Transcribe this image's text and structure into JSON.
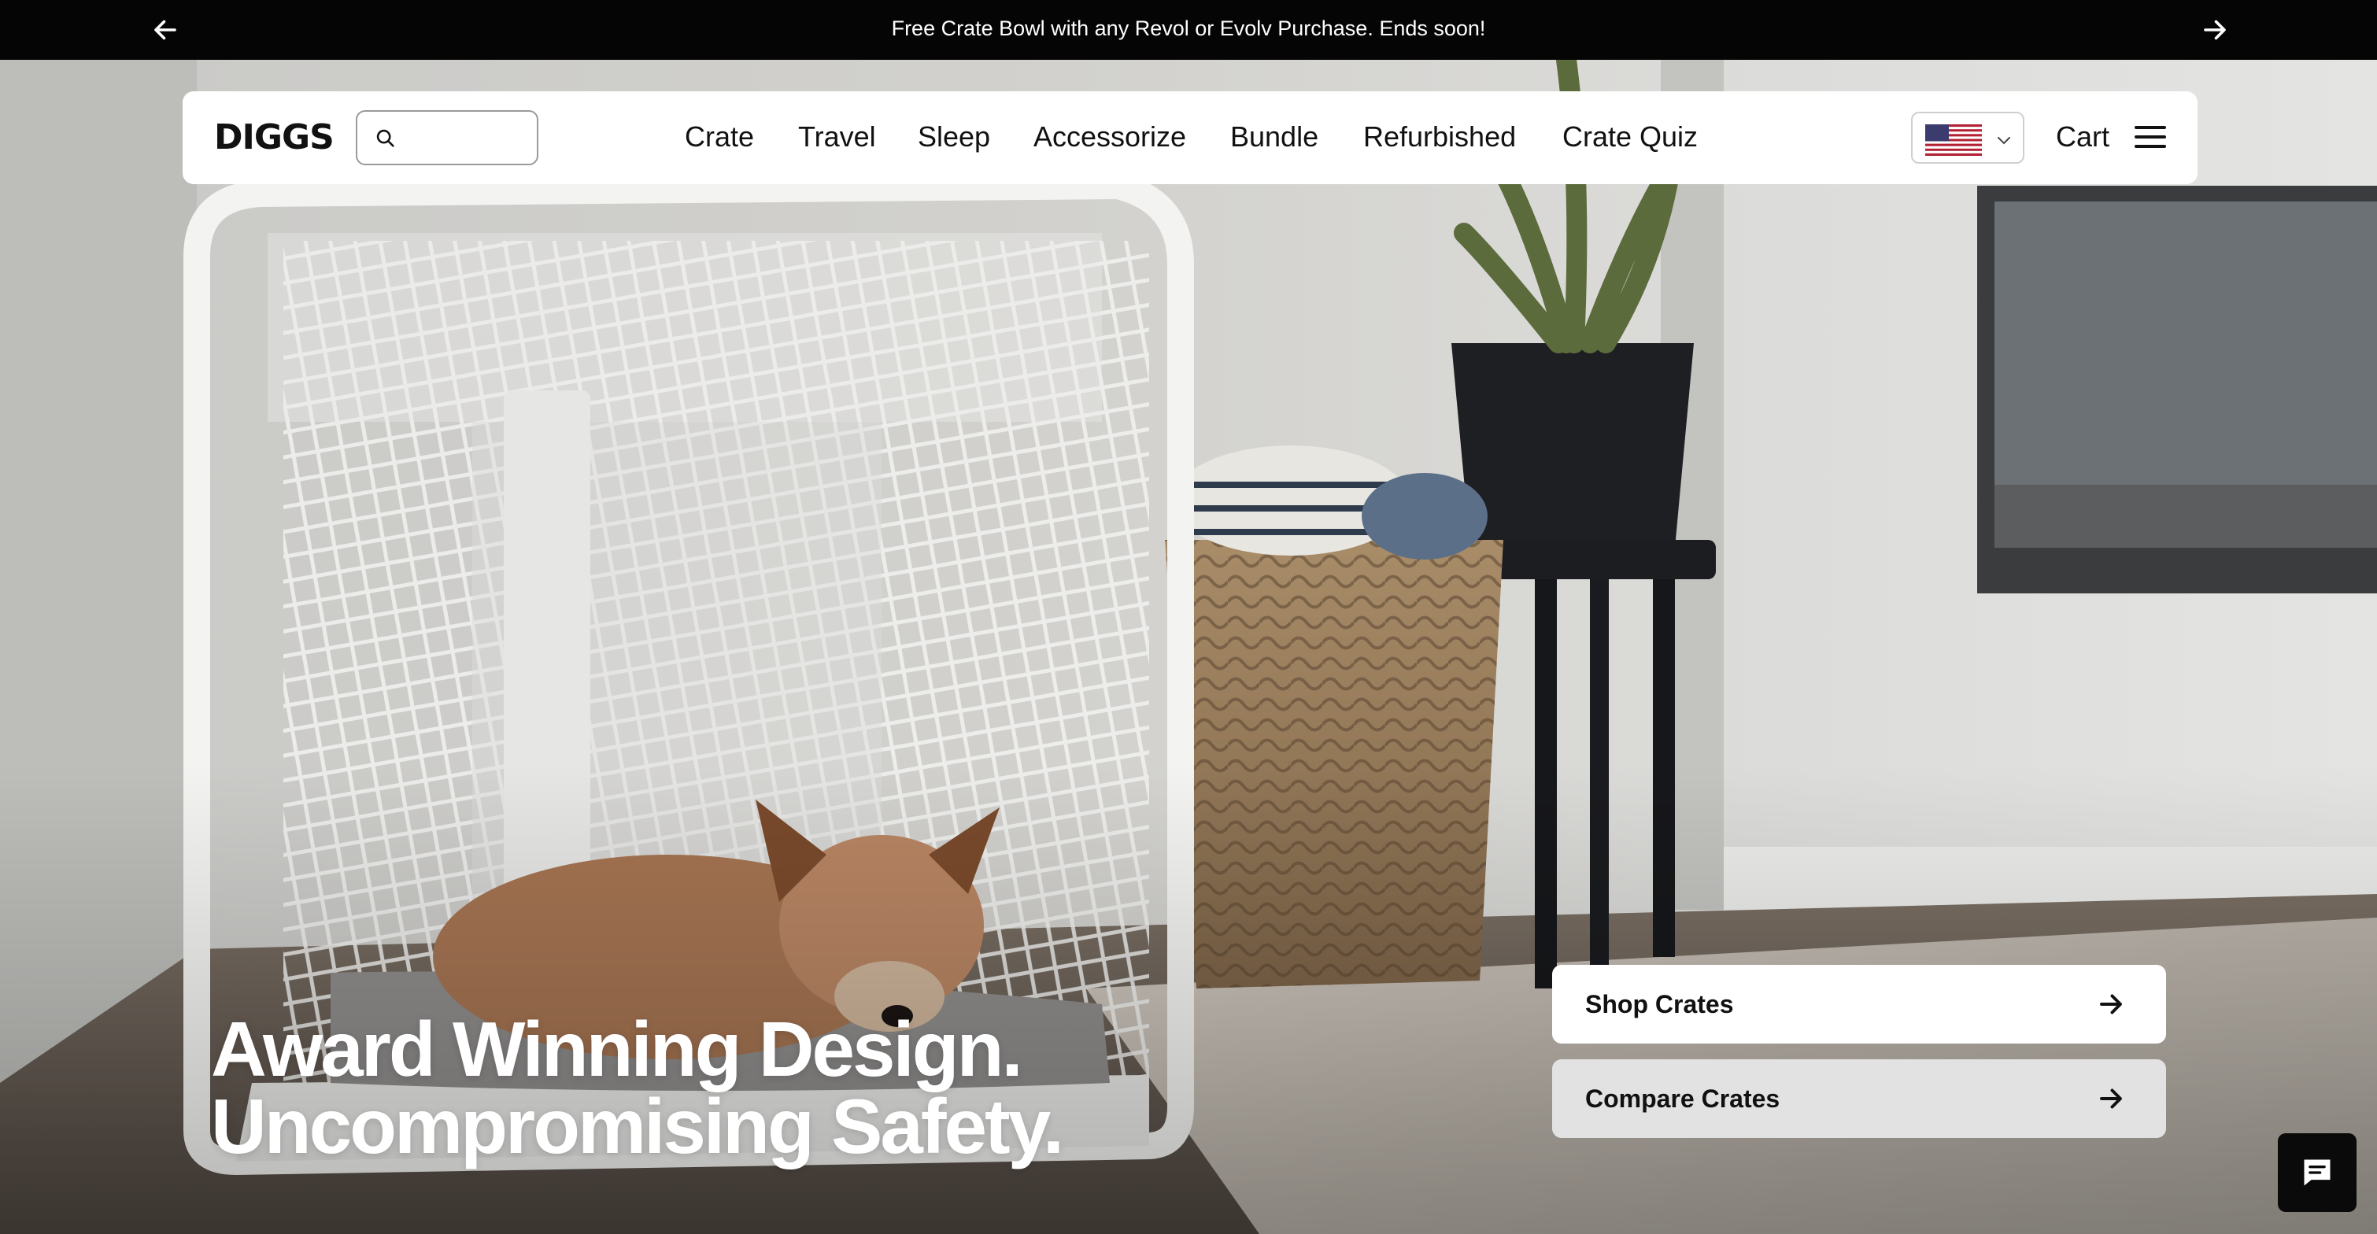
{
  "announcement": {
    "message": "Free Crate Bowl with any Revol or Evolv Purchase. Ends soon!",
    "prev_icon": "arrow-left-icon",
    "next_icon": "arrow-right-icon"
  },
  "header": {
    "logo": "DIGGS",
    "search": {
      "placeholder": "",
      "value": ""
    },
    "nav": [
      "Crate",
      "Travel",
      "Sleep",
      "Accessorize",
      "Bundle",
      "Refurbished",
      "Crate Quiz"
    ],
    "country_flag": "us-flag-icon",
    "cart_label": "Cart",
    "menu_icon": "hamburger-menu-icon"
  },
  "hero": {
    "headline_line1": "Award Winning Design.",
    "headline_line2": "Uncompromising Safety.",
    "buttons": [
      {
        "label": "Shop Crates",
        "icon": "arrow-right-icon"
      },
      {
        "label": "Compare Crates",
        "icon": "arrow-right-icon"
      }
    ]
  },
  "chat": {
    "icon": "chat-bubble-icon"
  },
  "colors": {
    "announcement_bg": "#050505",
    "header_bg": "#ffffff",
    "shop_button_bg": "#ffffff",
    "compare_button_bg": "#e2e2e2",
    "chat_bg": "#0a0a0a"
  }
}
